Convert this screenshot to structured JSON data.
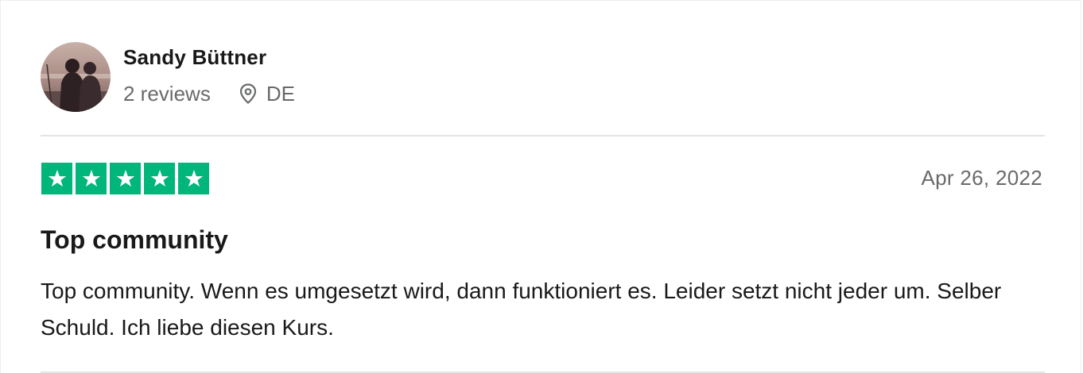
{
  "consumer": {
    "name": "Sandy Büttner",
    "reviews_count": "2 reviews",
    "country": "DE"
  },
  "review": {
    "rating": 5,
    "rating_max": 5,
    "date": "Apr 26, 2022",
    "title": "Top community",
    "text": "Top community. Wenn es umgesetzt wird, dann funktioniert es. Leider setzt nicht jeder um. Selber Schuld. Ich liebe diesen Kurs."
  },
  "icons": {
    "location": "location-pin-icon",
    "star": "star-icon"
  },
  "colors": {
    "star_background": "#00b67a",
    "star_glyph": "#ffffff",
    "muted_text": "#696a6a",
    "primary_text": "#191919"
  }
}
